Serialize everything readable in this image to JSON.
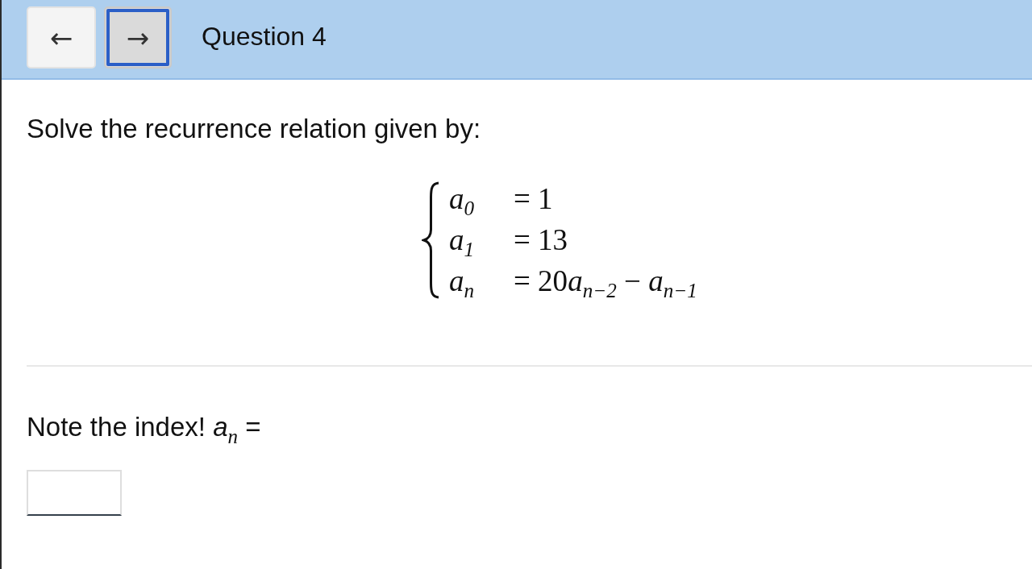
{
  "header": {
    "nav_buttons": [
      {
        "label": "←",
        "focused": false
      },
      {
        "label": "→",
        "focused": true
      }
    ],
    "title": "Question 4"
  },
  "question": {
    "prompt": "Solve the recurrence relation given by:",
    "system": [
      {
        "lhs": "*a*$_{0}$",
        "rhs": [
          "= 1"
        ]
      },
      {
        "lhs": "*a*$_{1}$",
        "rhs": [
          "= 13"
        ]
      },
      {
        "lhs": "*a*$_{n}$",
        "rhs": [
          "= 20",
          "*a*$_{n−2}$ − *a*$_{n−1}$"
        ]
      }
    ],
    "answer_label": "Note the index! *a*$_{n}$ ="
  }
}
